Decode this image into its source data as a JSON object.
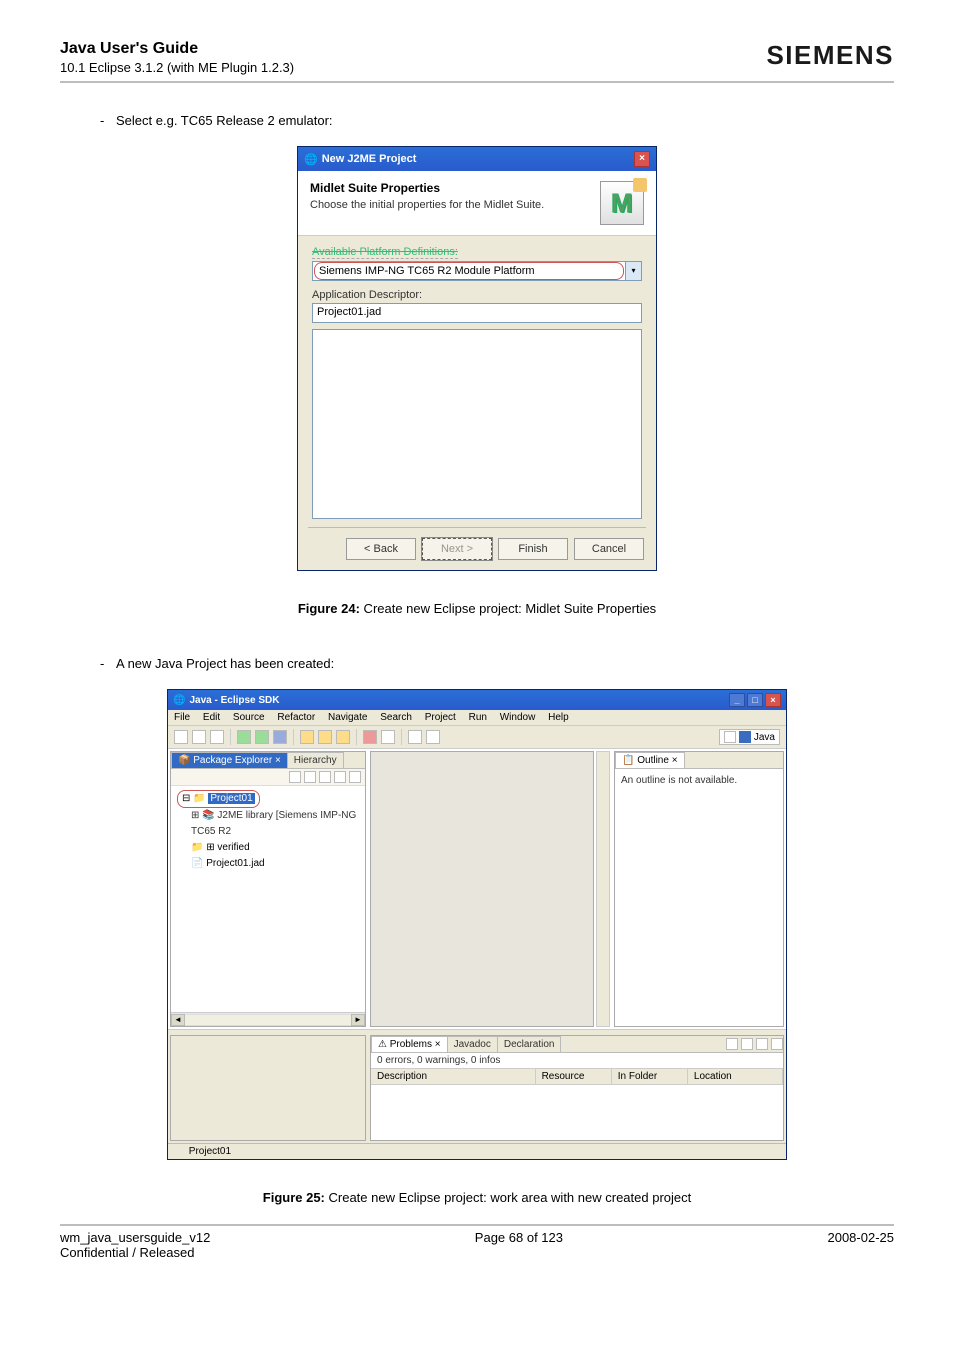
{
  "doc": {
    "title": "Java User's Guide",
    "subtitle": "10.1 Eclipse 3.1.2 (with ME Plugin 1.2.3)",
    "brand": "SIEMENS"
  },
  "bullet1": {
    "dash": "-",
    "text": "Select e.g. TC65 Release 2 emulator:"
  },
  "dialog1": {
    "title": "New J2ME Project",
    "head_title": "Midlet Suite Properties",
    "head_sub": "Choose the initial properties for the Midlet Suite.",
    "m_letter": "M",
    "apd_label": "Available Platform Definitions:",
    "platform_value": "Siemens IMP-NG TC65 R2 Module Platform",
    "chev": "▾",
    "ad_label": "Application Descriptor:",
    "ad_value": "Project01.jad",
    "btn_back": "< Back",
    "btn_next": "Next >",
    "btn_finish": "Finish",
    "btn_cancel": "Cancel"
  },
  "caption1_a": "Figure 24:",
  "caption1_b": "  Create new Eclipse project: Midlet Suite Properties",
  "bullet2": {
    "dash": "-",
    "text": "A new Java Project has been created:"
  },
  "ide": {
    "title": "Java - Eclipse SDK",
    "menu": {
      "file": "File",
      "edit": "Edit",
      "source": "Source",
      "refactor": "Refactor",
      "navigate": "Navigate",
      "search": "Search",
      "project": "Project",
      "run": "Run",
      "window": "Window",
      "help": "Help"
    },
    "persp_label": "Java",
    "pkg_tab": "Package Explorer",
    "hier_tab": "Hierarchy",
    "tree": {
      "project": "Project01",
      "lib": "J2ME library [Siemens IMP-NG TC65 R2",
      "verified": "verified",
      "jad": "Project01.jad"
    },
    "outline_tab": "Outline",
    "outline_text": "An outline is not available.",
    "problems_tab": "Problems",
    "javadoc_tab": "Javadoc",
    "decl_tab": "Declaration",
    "prob_summary": "0 errors, 0 warnings, 0 infos",
    "cols": {
      "desc": "Description",
      "res": "Resource",
      "inf": "In Folder",
      "loc": "Location"
    },
    "status": "Project01",
    "left_arrow": "◄",
    "right_arrow": "►",
    "min_glyph": "_",
    "max_glyph": "□",
    "close_glyph": "×"
  },
  "caption2_a": "Figure 25:",
  "caption2_b": "  Create new Eclipse project: work area with new created project",
  "footer": {
    "left": "wm_java_usersguide_v12",
    "center": "Page 68 of 123",
    "right": "2008-02-25",
    "left2": "Confidential / Released"
  }
}
